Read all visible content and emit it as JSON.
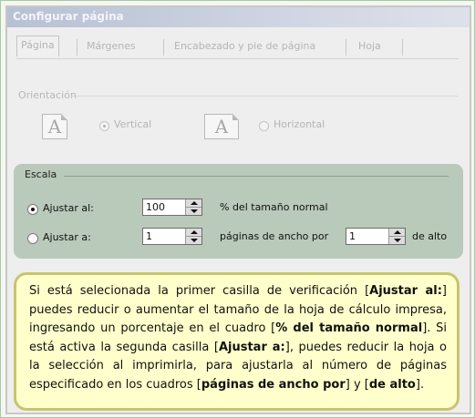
{
  "dialog": {
    "title": "Configurar página",
    "tabs": [
      {
        "label": "Página"
      },
      {
        "label": "Márgenes"
      },
      {
        "label": "Encabezado y pie de página"
      },
      {
        "label": "Hoja"
      }
    ],
    "orientation": {
      "legend": "Orientación",
      "vertical_label": "Vertical",
      "horizontal_label": "Horizontal",
      "selected": "Vertical",
      "page_icon_letter": "A"
    },
    "scale": {
      "legend": "Escala",
      "adjust_to_label": "Ajustar al:",
      "adjust_to_value": "100",
      "adjust_to_suffix": "% del tamaño normal",
      "fit_to_label": "Ajustar a:",
      "fit_wide_value": "1",
      "fit_wide_suffix": "páginas de ancho por",
      "fit_tall_value": "1",
      "fit_tall_suffix": "de alto",
      "selected": "Ajustar al:"
    }
  },
  "note": {
    "t1": "Si está selecionada la primer casilla de verificación [",
    "b1": "Ajustar al:",
    "t2": "] puedes reducir o aumentar el tamaño de la hoja de cálculo impresa, ingresando un porcentaje en el cuadro [",
    "b2": "% del tamaño normal",
    "t3": "]. Si está activa la segunda casilla [",
    "b3": "Ajustar a:",
    "t4": "], puedes reducir la hoja o la selección al imprimirla, para ajustarla al número de páginas especificado en los cuadros [",
    "b4": "páginas de ancho por",
    "t5": "] y [",
    "b5": "de alto",
    "t6": "]."
  },
  "colors": {
    "scale_panel": "#b9c9ba",
    "note_background": "#ffffcc",
    "note_border": "#c7c56d",
    "title_bar": "#c4cad8"
  }
}
